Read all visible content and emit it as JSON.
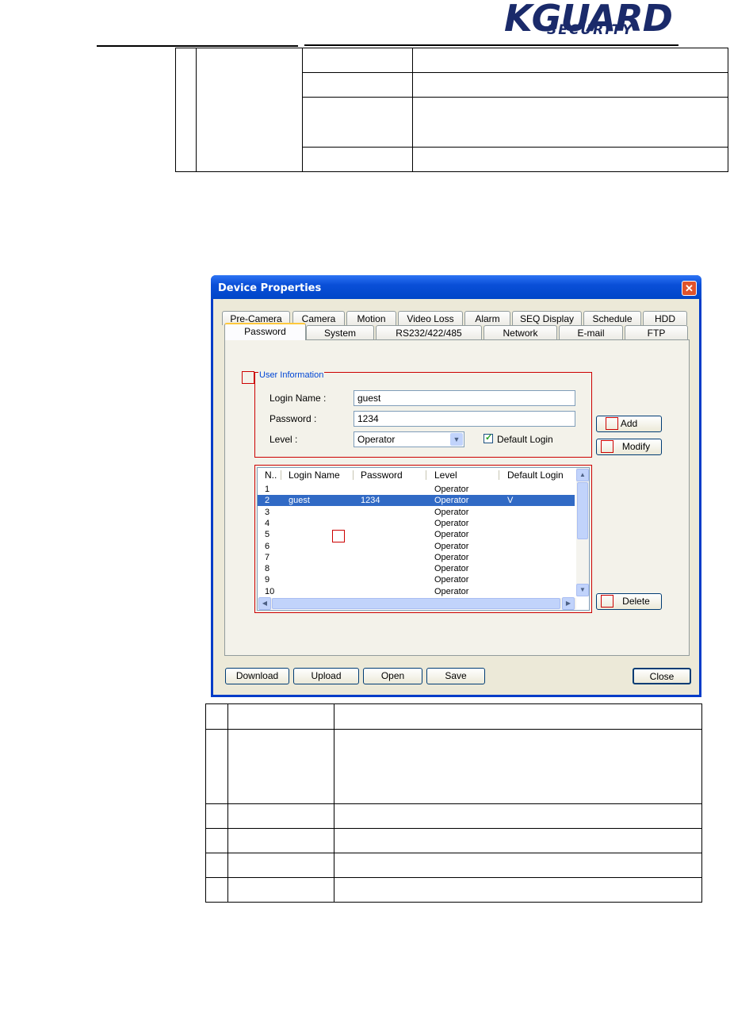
{
  "header": {
    "logo_main": "KGUARD",
    "logo_sub": "SECURITY"
  },
  "dialog": {
    "title": "Device Properties",
    "close_glyph": "✕",
    "tabs_row1": [
      "Pre-Camera",
      "Camera",
      "Motion",
      "Video Loss",
      "Alarm",
      "SEQ Display",
      "Schedule",
      "HDD"
    ],
    "tabs_row2": [
      "Password",
      "System",
      "RS232/422/485",
      "Network",
      "E-mail",
      "FTP"
    ],
    "active_tab": "Password",
    "user_info": {
      "group_label": "User Information",
      "login_name_label": "Login Name :",
      "login_name_value": "guest",
      "password_label": "Password :",
      "password_value": "1234",
      "level_label": "Level :",
      "level_value": "Operator",
      "default_login_label": "Default Login",
      "default_login_checked": true
    },
    "buttons": {
      "add": "Add",
      "modify": "Modify",
      "delete": "Delete",
      "download": "Download",
      "upload": "Upload",
      "open": "Open",
      "save": "Save",
      "close": "Close"
    },
    "user_list": {
      "columns": [
        "N..",
        "Login Name",
        "Password",
        "Level",
        "Default Login"
      ],
      "selected_index": 1,
      "rows": [
        {
          "n": "1",
          "login": "",
          "password": "",
          "level": "Operator",
          "default": ""
        },
        {
          "n": "2",
          "login": "guest",
          "password": "1234",
          "level": "Operator",
          "default": "V"
        },
        {
          "n": "3",
          "login": "",
          "password": "",
          "level": "Operator",
          "default": ""
        },
        {
          "n": "4",
          "login": "",
          "password": "",
          "level": "Operator",
          "default": ""
        },
        {
          "n": "5",
          "login": "",
          "password": "",
          "level": "Operator",
          "default": ""
        },
        {
          "n": "6",
          "login": "",
          "password": "",
          "level": "Operator",
          "default": ""
        },
        {
          "n": "7",
          "login": "",
          "password": "",
          "level": "Operator",
          "default": ""
        },
        {
          "n": "8",
          "login": "",
          "password": "",
          "level": "Operator",
          "default": ""
        },
        {
          "n": "9",
          "login": "",
          "password": "",
          "level": "Operator",
          "default": ""
        },
        {
          "n": "10",
          "login": "",
          "password": "",
          "level": "Operator",
          "default": ""
        }
      ]
    }
  }
}
